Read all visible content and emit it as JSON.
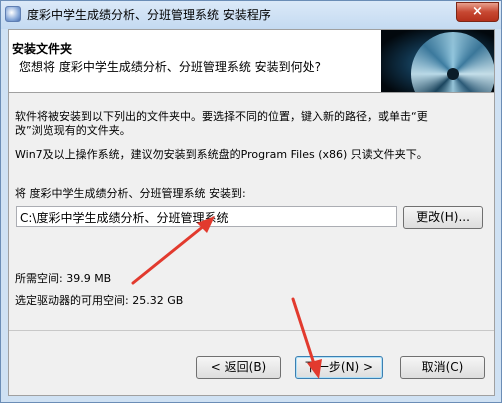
{
  "window": {
    "title": "度彩中学生成绩分析、分班管理系统 安装程序",
    "close_glyph": "×"
  },
  "header": {
    "title": "安装文件夹",
    "subtitle": "您想将 度彩中学生成绩分析、分班管理系统 安装到何处?"
  },
  "body": {
    "instruction_line1": "软件将被安装到以下列出的文件夹中。要选择不同的位置，键入新的路径，或单击“更",
    "instruction_line2": "改”浏览现有的文件夹。",
    "note": "Win7及以上操作系统，建议勿安装到系统盘的Program Files (x86) 只读文件夹下。",
    "install_to_label": "将 度彩中学生成绩分析、分班管理系统 安装到:",
    "install_path": "C:\\度彩中学生成绩分析、分班管理系统",
    "change_button": "更改(H)...",
    "space_required": "所需空间: 39.9 MB",
    "space_available": "选定驱动器的可用空间: 25.32 GB"
  },
  "footer": {
    "back_button": "< 返回(B)",
    "next_button": "下一步(N) >",
    "cancel_button": "取消(C)"
  },
  "colors": {
    "annotation_arrow": "#e23a2e"
  }
}
